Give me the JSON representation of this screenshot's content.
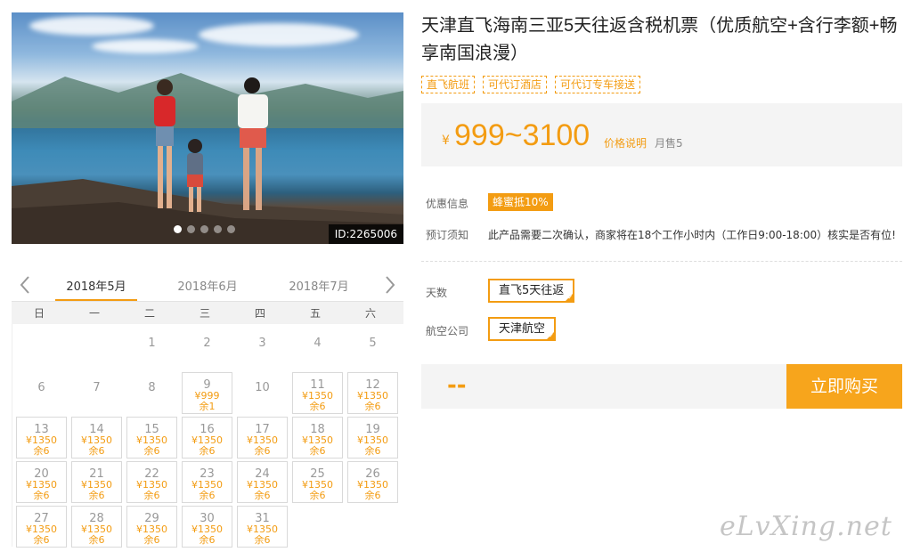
{
  "hero": {
    "id_label": "ID:2265006",
    "slide_count": 5,
    "active_slide": 1
  },
  "product": {
    "title": "天津直飞海南三亚5天往返含税机票（优质航空+含行李额+畅享南国浪漫）",
    "tags": [
      "直飞航班",
      "可代订酒店",
      "可代订专车接送"
    ]
  },
  "price": {
    "currency": "¥",
    "range": "999~3100",
    "explain_label": "价格说明",
    "sales_label": "月售5"
  },
  "promo": {
    "label": "优惠信息",
    "badge": "蜂蜜抵10%"
  },
  "booking": {
    "label": "预订须知",
    "text": "此产品需要二次确认，商家将在18个工作小时内（工作日9:00-18:00）核实是否有位!"
  },
  "options": {
    "days_label": "天数",
    "days_value": "直飞5天往返",
    "airline_label": "航空公司",
    "airline_value": "天津航空"
  },
  "purchase": {
    "placeholder_price": "--",
    "buy_label": "立即购买"
  },
  "calendar": {
    "months": [
      "2018年5月",
      "2018年6月",
      "2018年7月"
    ],
    "active_month": 0,
    "weekdays": [
      "日",
      "一",
      "二",
      "三",
      "四",
      "五",
      "六"
    ],
    "leading_blanks": 2,
    "days": [
      {
        "d": "1"
      },
      {
        "d": "2"
      },
      {
        "d": "3"
      },
      {
        "d": "4"
      },
      {
        "d": "5"
      },
      {
        "d": "6"
      },
      {
        "d": "7"
      },
      {
        "d": "8"
      },
      {
        "d": "9",
        "price": "¥999",
        "left": "余1"
      },
      {
        "d": "10"
      },
      {
        "d": "11",
        "price": "¥1350",
        "left": "余6"
      },
      {
        "d": "12",
        "price": "¥1350",
        "left": "余6"
      },
      {
        "d": "13",
        "price": "¥1350",
        "left": "余6"
      },
      {
        "d": "14",
        "price": "¥1350",
        "left": "余6"
      },
      {
        "d": "15",
        "price": "¥1350",
        "left": "余6"
      },
      {
        "d": "16",
        "price": "¥1350",
        "left": "余6"
      },
      {
        "d": "17",
        "price": "¥1350",
        "left": "余6"
      },
      {
        "d": "18",
        "price": "¥1350",
        "left": "余6"
      },
      {
        "d": "19",
        "price": "¥1350",
        "left": "余6"
      },
      {
        "d": "20",
        "price": "¥1350",
        "left": "余6"
      },
      {
        "d": "21",
        "price": "¥1350",
        "left": "余6"
      },
      {
        "d": "22",
        "price": "¥1350",
        "left": "余6"
      },
      {
        "d": "23",
        "price": "¥1350",
        "left": "余6"
      },
      {
        "d": "24",
        "price": "¥1350",
        "left": "余6"
      },
      {
        "d": "25",
        "price": "¥1350",
        "left": "余6"
      },
      {
        "d": "26",
        "price": "¥1350",
        "left": "余6"
      },
      {
        "d": "27",
        "price": "¥1350",
        "left": "余6"
      },
      {
        "d": "28",
        "price": "¥1350",
        "left": "余6"
      },
      {
        "d": "29",
        "price": "¥1350",
        "left": "余6"
      },
      {
        "d": "30",
        "price": "¥1350",
        "left": "余6"
      },
      {
        "d": "31",
        "price": "¥1350",
        "left": "余6"
      }
    ]
  },
  "watermark": "eLvXing.net",
  "colors": {
    "accent": "#f39c12",
    "buy": "#f7a51c",
    "panel": "#f4f4f4"
  }
}
